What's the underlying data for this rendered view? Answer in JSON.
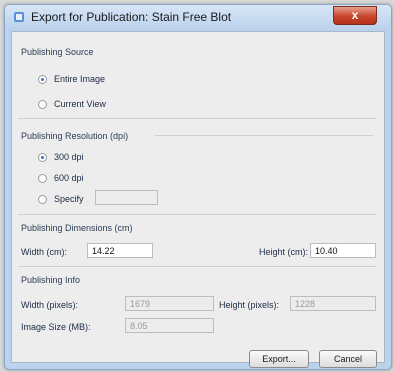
{
  "window": {
    "title": "Export for Publication: Stain Free Blot",
    "close_glyph": "x"
  },
  "publishing_source": {
    "heading": "Publishing Source",
    "options": [
      {
        "label": "Entire Image",
        "checked": true
      },
      {
        "label": "Current View",
        "checked": false
      }
    ]
  },
  "publishing_resolution": {
    "heading": "Publishing Resolution (dpi)",
    "options": [
      {
        "label": "300 dpi",
        "checked": true
      },
      {
        "label": "600 dpi",
        "checked": false
      },
      {
        "label": "Specify",
        "checked": false
      }
    ],
    "specify_value": ""
  },
  "publishing_dimensions": {
    "heading": "Publishing Dimensions (cm)",
    "width_label": "Width (cm):",
    "width_value": "14.22",
    "height_label": "Height (cm):",
    "height_value": "10.40"
  },
  "publishing_info": {
    "heading": "Publishing Info",
    "width_px_label": "Width (pixels):",
    "width_px_value": "1679",
    "height_px_label": "Height (pixels):",
    "height_px_value": "1228",
    "image_size_label": "Image Size (MB):",
    "image_size_value": "8.05"
  },
  "buttons": {
    "export": "Export...",
    "cancel": "Cancel"
  },
  "colors": {
    "accent": "#3a6fc9",
    "close": "#c9452b"
  },
  "icons": {
    "app": "app-icon",
    "close": "close-icon"
  }
}
